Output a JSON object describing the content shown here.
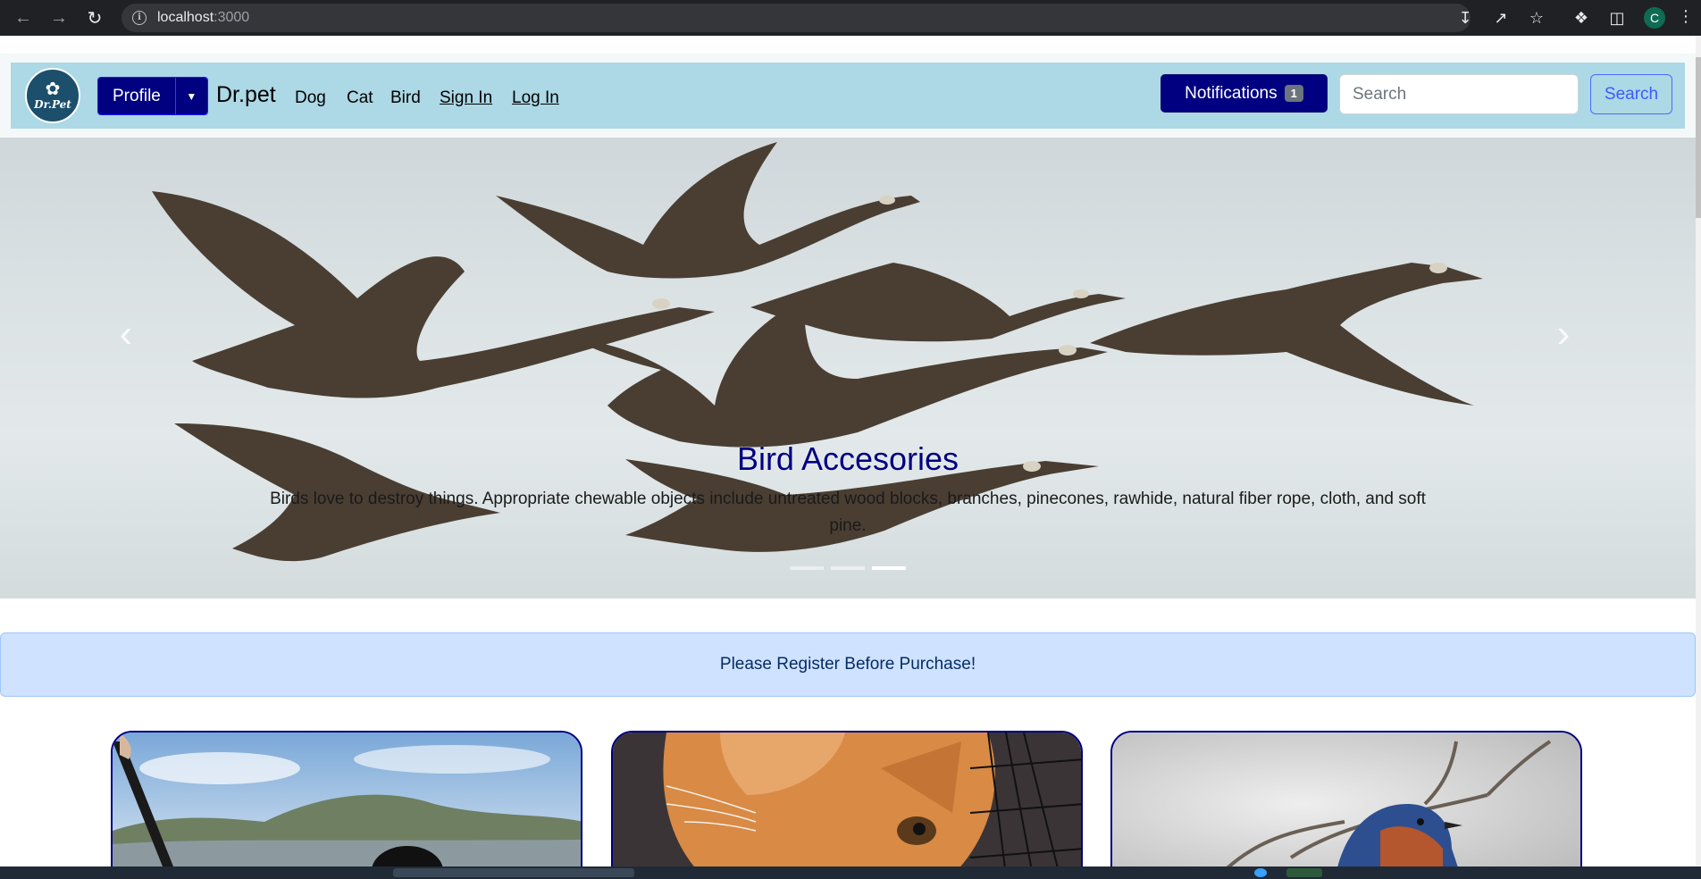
{
  "browser": {
    "url_host": "localhost",
    "url_port": ":3000",
    "profile_initial": "C"
  },
  "navbar": {
    "logo_text": "Dr.Pet",
    "profile_label": "Profile",
    "brand": "Dr.pet",
    "links": [
      "Dog",
      "Cat",
      "Bird",
      "Sign In",
      "Log In"
    ],
    "notifications_label": "Notifications",
    "notifications_count": "1",
    "search_placeholder": "Search",
    "search_button": "Search",
    "bg_color": "#add8e6",
    "accent_color": "#000080"
  },
  "carousel": {
    "title": "Bird Accesories",
    "text": "Birds love to destroy things. Appropriate chewable objects include untreated wood blocks, branches, pinecones, rawhide, natural fiber rope, cloth, and soft pine.",
    "slide_count": 3,
    "active_index": 2
  },
  "alert": {
    "text": "Please Register Before Purchase!",
    "bg_color": "#cfe2ff"
  },
  "cards": [
    {
      "subject": "dog"
    },
    {
      "subject": "cat"
    },
    {
      "subject": "bird"
    }
  ]
}
